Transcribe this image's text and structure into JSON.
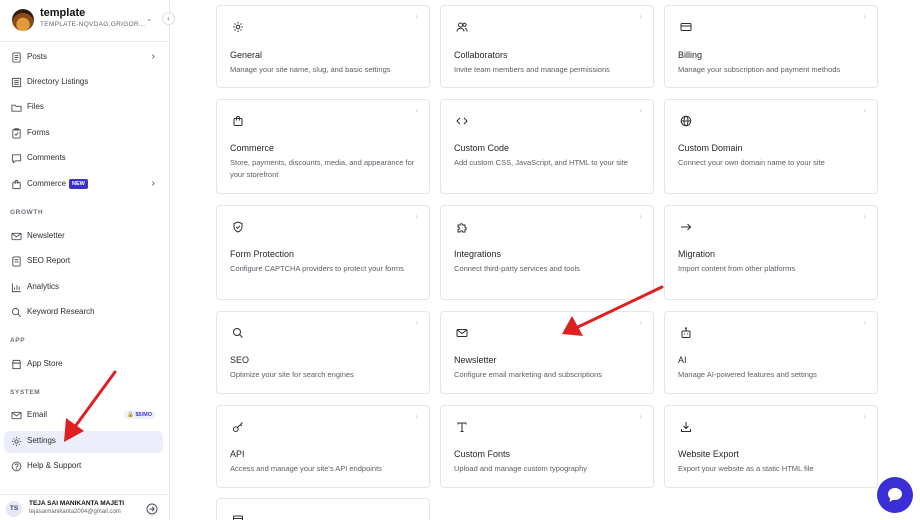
{
  "workspace": {
    "name": "template",
    "subtitle": "TEMPLATE-NQVDAG.GRIGOR..."
  },
  "sidebar": {
    "items": [
      {
        "label": "Posts",
        "icon": "posts-icon"
      },
      {
        "label": "Directory Listings",
        "icon": "directory-icon"
      },
      {
        "label": "Files",
        "icon": "folder-icon"
      },
      {
        "label": "Forms",
        "icon": "forms-icon"
      },
      {
        "label": "Comments",
        "icon": "comment-icon"
      },
      {
        "label": "Commerce",
        "icon": "bag-icon",
        "badge": "NEW"
      }
    ],
    "sections": {
      "growth": "GROWTH",
      "app": "APP",
      "system": "SYSTEM"
    },
    "growth_items": [
      {
        "label": "Newsletter",
        "icon": "mail-icon"
      },
      {
        "label": "SEO Report",
        "icon": "report-icon"
      },
      {
        "label": "Analytics",
        "icon": "chart-icon"
      },
      {
        "label": "Keyword Research",
        "icon": "search-icon"
      }
    ],
    "app_items": [
      {
        "label": "App Store",
        "icon": "store-icon"
      }
    ],
    "system_items": [
      {
        "label": "Email",
        "icon": "mail-icon",
        "badge": "$5/MO"
      },
      {
        "label": "Settings",
        "icon": "gear-icon",
        "active": true
      },
      {
        "label": "Help & Support",
        "icon": "help-icon"
      }
    ]
  },
  "user": {
    "initials": "TS",
    "name": "TEJA SAI MANIKANTA MAJETI",
    "email": "tejasaimanikanta2004@gmail.com"
  },
  "cards": [
    {
      "title": "General",
      "desc": "Manage your site name, slug, and basic settings",
      "icon": "gear-icon"
    },
    {
      "title": "Collaborators",
      "desc": "Invite team members and manage permissions",
      "icon": "users-icon"
    },
    {
      "title": "Billing",
      "desc": "Manage your subscription and payment methods",
      "icon": "card-icon"
    },
    {
      "title": "Commerce",
      "desc": "Store, payments, discounts, media, and appearance for your storefront",
      "icon": "bag-icon"
    },
    {
      "title": "Custom Code",
      "desc": "Add custom CSS, JavaScript, and HTML to your site",
      "icon": "code-icon"
    },
    {
      "title": "Custom Domain",
      "desc": "Connect your own domain name to your site",
      "icon": "globe-icon"
    },
    {
      "title": "Form Protection",
      "desc": "Configure CAPTCHA providers to protect your forms",
      "icon": "shield-icon"
    },
    {
      "title": "Integrations",
      "desc": "Connect third-party services and tools",
      "icon": "puzzle-icon"
    },
    {
      "title": "Migration",
      "desc": "Import content from other platforms",
      "icon": "arrow-right-icon"
    },
    {
      "title": "SEO",
      "desc": "Optimize your site for search engines",
      "icon": "search-icon"
    },
    {
      "title": "Newsletter",
      "desc": "Configure email marketing and subscriptions",
      "icon": "mail-icon"
    },
    {
      "title": "AI",
      "desc": "Manage AI-powered features and settings",
      "icon": "bot-icon"
    },
    {
      "title": "API",
      "desc": "Access and manage your site's API endpoints",
      "icon": "key-icon"
    },
    {
      "title": "Custom Fonts",
      "desc": "Upload and manage custom typography",
      "icon": "type-icon"
    },
    {
      "title": "Website Export",
      "desc": "Export your website as a static HTML file",
      "icon": "download-icon"
    }
  ],
  "colors": {
    "accent": "#3b2fd0",
    "annotation_arrow": "#e02020",
    "active_bg": "#eceefb"
  }
}
